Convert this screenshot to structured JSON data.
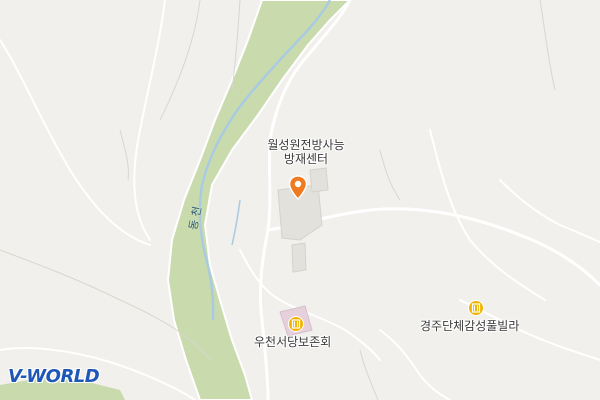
{
  "map": {
    "brand": {
      "prefix": "V",
      "rest": "-WORLD",
      "color": "#1f57b8"
    },
    "labels": {
      "center_line1": "월성원전방사능",
      "center_line2": "방재센터",
      "poi_villa": "경주단체감성풀빌라",
      "poi_hall": "우천서당보존회",
      "river": "동 천"
    },
    "icons": {
      "location_pin": "map-marker",
      "poi_building": "building"
    },
    "colors": {
      "background": "#f1f0ec",
      "green_band": "#c9dbad",
      "river": "#a9cbe2",
      "road": "#ffffff",
      "pin": "#ef7a1f",
      "poi": "#f0b400"
    }
  }
}
